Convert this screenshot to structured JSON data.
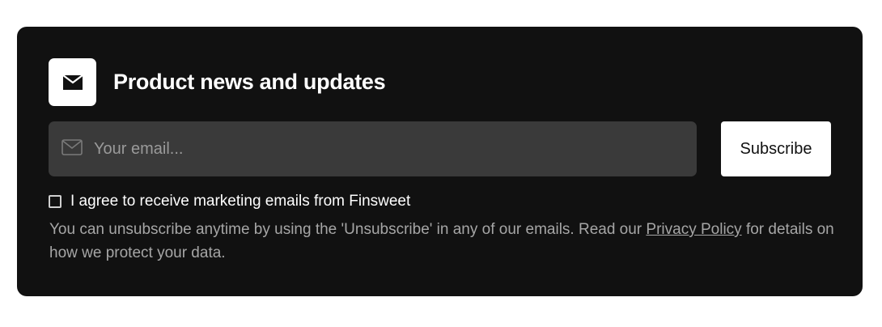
{
  "newsletter": {
    "title": "Product news and updates",
    "icons": {
      "header": "envelope-icon",
      "field": "envelope-outline-icon"
    },
    "email_placeholder": "Your email...",
    "email_value": "",
    "subscribe_label": "Subscribe",
    "consent": {
      "checked": false,
      "label": "I agree to receive marketing emails from Finsweet"
    },
    "disclaimer": {
      "before_link": "You can unsubscribe anytime by using the 'Unsubscribe' in any of our emails. Read our ",
      "link_text": "Privacy Policy",
      "after_link": " for details on how we protect your data."
    }
  },
  "colors": {
    "card_background": "#111111",
    "field_background": "#3a3a3a",
    "button_background": "#ffffff",
    "muted_text": "#a6a6a6"
  }
}
